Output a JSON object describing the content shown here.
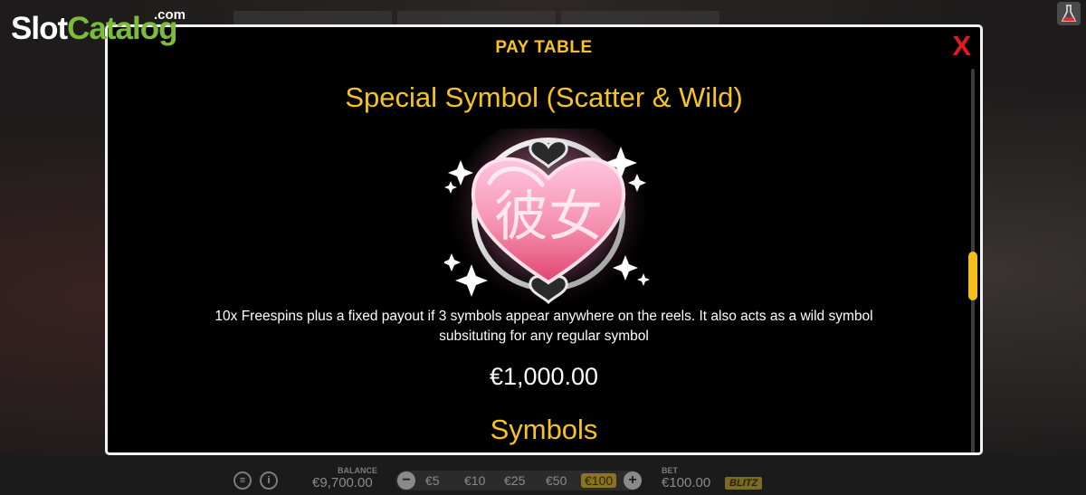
{
  "watermark": {
    "brand_part1": "Slot",
    "brand_part2": "Catalog",
    "brand_suffix": ".com"
  },
  "modal": {
    "title": "PAY TABLE",
    "close_glyph": "X",
    "section1_title": "Special Symbol (Scatter & Wild)",
    "symbol_glyph": "彼女",
    "description": "10x Freespins plus a fixed payout if 3 symbols appear anywhere on the reels. It also acts as a wild symbol subsituting for any regular symbol",
    "payout": "€1,000.00",
    "section2_title": "Symbols",
    "scroll_position": 0.55
  },
  "bottom_bar": {
    "balance_label": "BALANCE",
    "balance_value": "€9,700.00",
    "bet_options": [
      "€5",
      "€10",
      "€25",
      "€50",
      "€100"
    ],
    "selected_bet": "€100",
    "decrease_glyph": "−",
    "increase_glyph": "+",
    "bet_label": "BET",
    "bet_value": "€100.00",
    "blitz_label": "BLITZ",
    "menu_icon": "menu-icon",
    "info_glyph": "i"
  },
  "colors": {
    "accent_gold": "#f6c324",
    "close_red": "#e41b1b",
    "brand_green": "#7dbb3a",
    "heart_pink": "#f58fb0"
  }
}
